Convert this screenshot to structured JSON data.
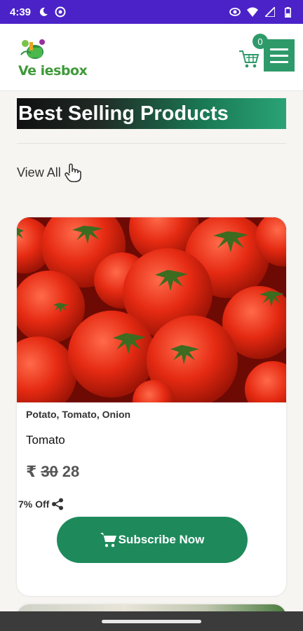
{
  "status_bar": {
    "time": "4:39",
    "icons_left": [
      "moon-icon",
      "do-not-disturb-icon"
    ],
    "icons_right": [
      "eye-icon",
      "wifi-icon",
      "signal-icon",
      "battery-icon"
    ]
  },
  "header": {
    "logo_text": "Ve iesbox",
    "cart_count": "0",
    "icons": [
      "cart-icon",
      "menu-icon"
    ]
  },
  "section": {
    "title": "Best Selling Products",
    "view_all": "View All"
  },
  "product": {
    "category": "Potato, Tomato, Onion",
    "name": "Tomato",
    "currency": "₹",
    "old_price": "30",
    "price": "28",
    "discount": "7% Off",
    "subscribe_label": "Subscribe Now"
  },
  "colors": {
    "status_bar": "#4a22c8",
    "accent": "#2e9a6a",
    "button": "#1e8a5c"
  }
}
